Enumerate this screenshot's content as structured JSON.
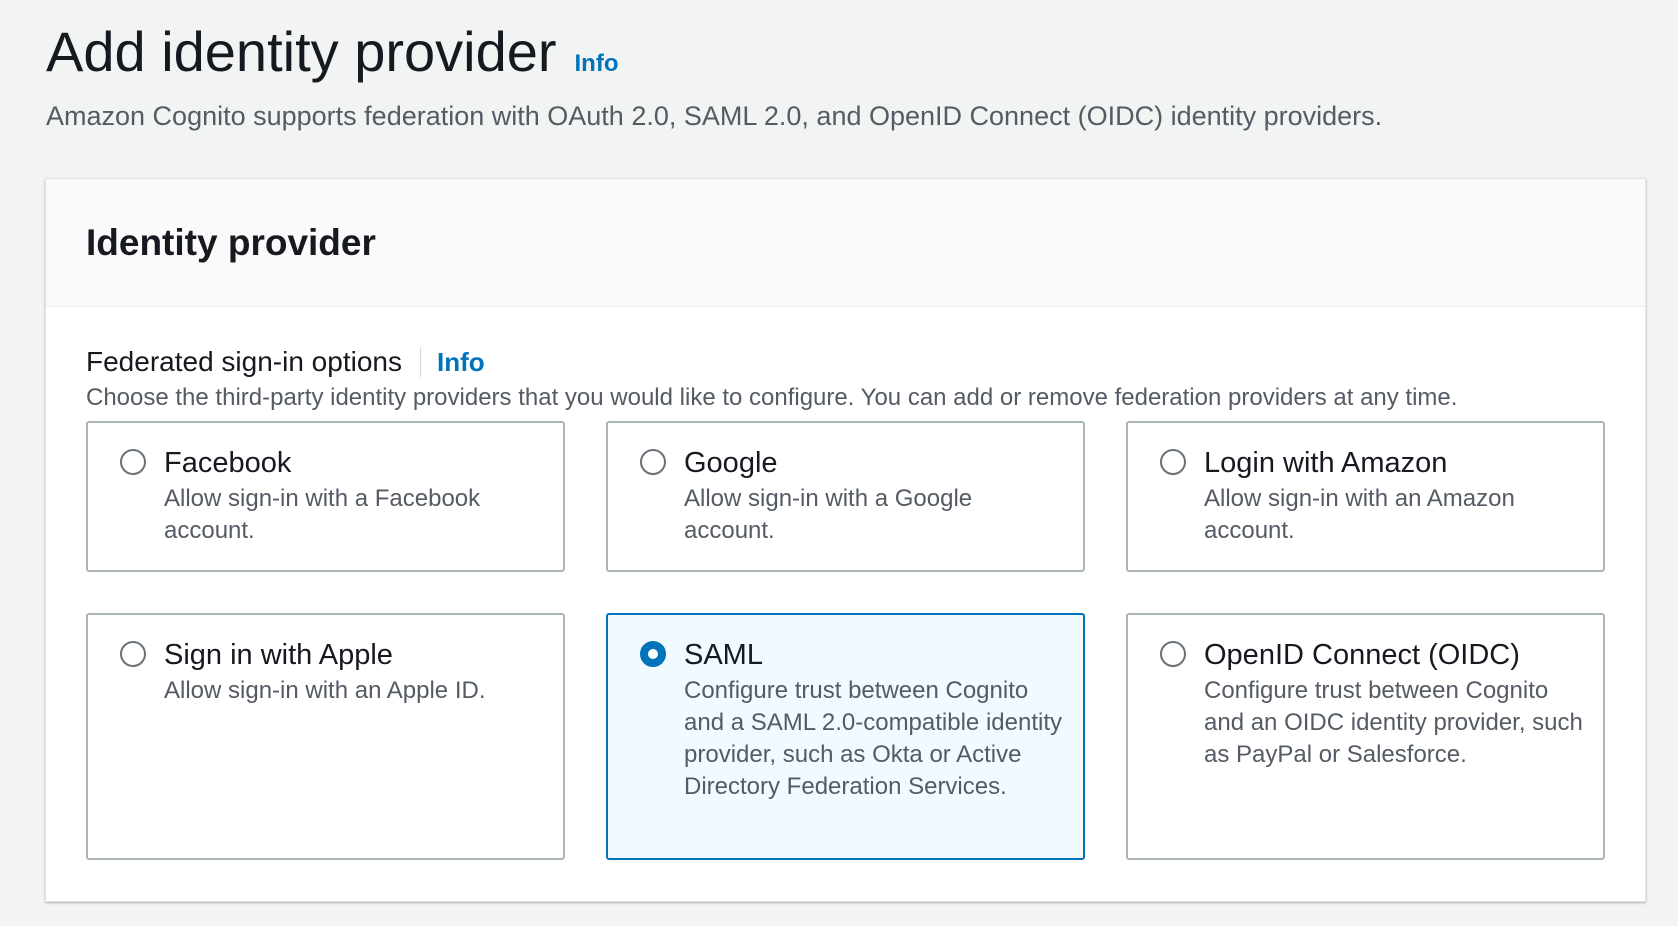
{
  "header": {
    "title": "Add identity provider",
    "info_label": "Info",
    "description": "Amazon Cognito supports federation with OAuth 2.0, SAML 2.0, and OpenID Connect (OIDC) identity providers."
  },
  "panel": {
    "title": "Identity provider",
    "field": {
      "label": "Federated sign-in options",
      "info_label": "Info",
      "description": "Choose the third-party identity providers that you would like to configure. You can add or remove federation providers at any time."
    },
    "options": [
      {
        "title": "Facebook",
        "description": "Allow sign-in with a Facebook account."
      },
      {
        "title": "Google",
        "description": "Allow sign-in with a Google account."
      },
      {
        "title": "Login with Amazon",
        "description": "Allow sign-in with an Amazon account."
      },
      {
        "title": "Sign in with Apple",
        "description": "Allow sign-in with an Apple ID."
      },
      {
        "title": "SAML",
        "description": "Configure trust between Cognito and a SAML 2.0-compatible identity provider, such as Okta or Active Directory Federation Services."
      },
      {
        "title": "OpenID Connect (OIDC)",
        "description": "Configure trust between Cognito and an OIDC identity provider, such as PayPal or Salesforce."
      }
    ],
    "selected_option": "SAML"
  },
  "colors": {
    "accent": "#0073bb",
    "selected_background": "#f1faff"
  }
}
